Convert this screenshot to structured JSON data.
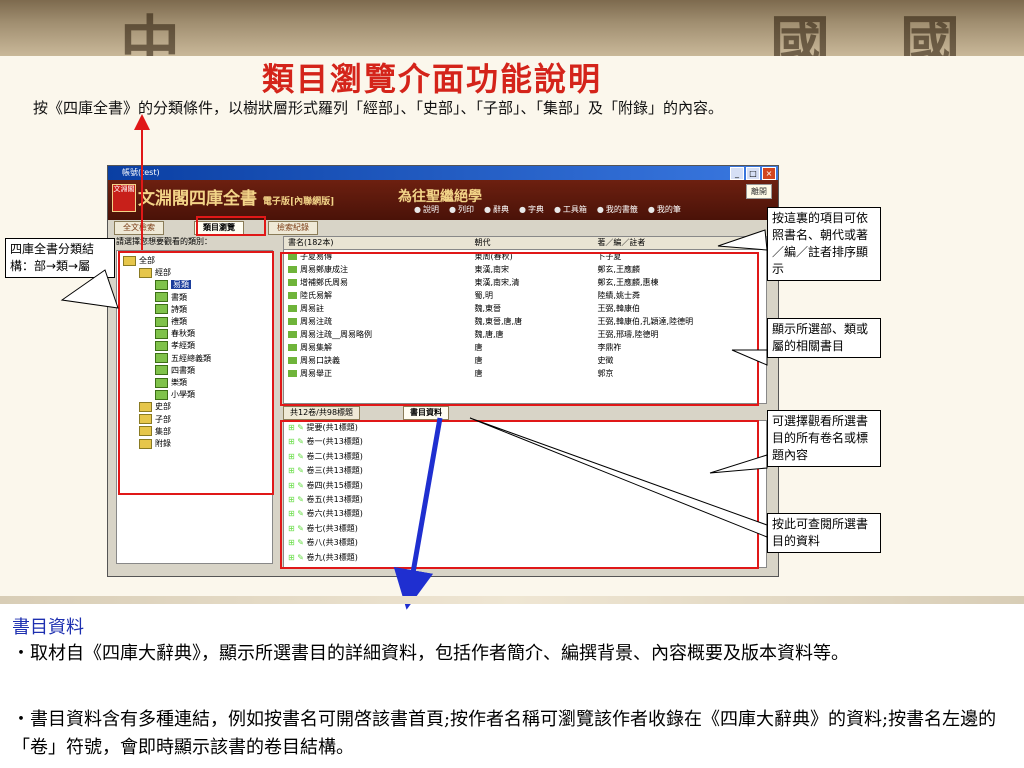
{
  "banner": {
    "glyphs": [
      "中",
      "國",
      "國"
    ]
  },
  "slide": {
    "title": "類目瀏覽介面功能說明",
    "intro": "按《四庫全書》的分類條件，以樹狀層形式羅列「經部」、「史部」、「子部」、「集部」及「附錄」的內容。"
  },
  "app": {
    "window_title": "帳號(test)",
    "logo": "文淵閣",
    "name": "文淵閣四庫全書",
    "edition": "電子版[內聯網版]",
    "motto": "為往聖繼絕學",
    "exit": "離開",
    "toolbar": [
      "說明",
      "列印",
      "辭典",
      "字典",
      "工具箱",
      "我的書籤",
      "我的筆"
    ],
    "tabs": [
      "全文檢索",
      "類目瀏覽",
      "檢索紀錄"
    ],
    "tree_prompt": "請選擇您想要觀看的類別：",
    "tree": [
      {
        "label": "全部",
        "level": 0
      },
      {
        "label": "經部",
        "level": 1
      },
      {
        "label": "易類",
        "level": 2,
        "selected": true
      },
      {
        "label": "書類",
        "level": 2
      },
      {
        "label": "詩類",
        "level": 2
      },
      {
        "label": "禮類",
        "level": 2
      },
      {
        "label": "春秋類",
        "level": 2
      },
      {
        "label": "孝經類",
        "level": 2
      },
      {
        "label": "五經總義類",
        "level": 2
      },
      {
        "label": "四書類",
        "level": 2
      },
      {
        "label": "樂類",
        "level": 2
      },
      {
        "label": "小學類",
        "level": 2
      },
      {
        "label": "史部",
        "level": 1
      },
      {
        "label": "子部",
        "level": 1
      },
      {
        "label": "集部",
        "level": 1
      },
      {
        "label": "附錄",
        "level": 1
      }
    ],
    "grid_headers": [
      "書名(182本)",
      "朝代",
      "著／編／註者"
    ],
    "grid_rows": [
      [
        "子夏易傳",
        "東周(春秋)",
        "卜子夏"
      ],
      [
        "周易鄭康成注",
        "東漢,南宋",
        "鄭玄,王應麟"
      ],
      [
        "增補鄭氏周易",
        "東漢,南宋,清",
        "鄭玄,王應麟,惠棟"
      ],
      [
        "陸氏易解",
        "蜀,明",
        "陸績,姚士粦"
      ],
      [
        "周易註",
        "魏,東晉",
        "王弼,韓康伯"
      ],
      [
        "周易注疏",
        "魏,東晉,唐,唐",
        "王弼,韓康伯,孔穎達,陸德明"
      ],
      [
        "周易注疏__周易略例",
        "魏,唐,唐",
        "王弼,邢璹,陸德明"
      ],
      [
        "周易集解",
        "唐",
        "李鼎祚"
      ],
      [
        "周易口訣義",
        "唐",
        "史徵"
      ],
      [
        "周易舉正",
        "唐",
        "郭京"
      ]
    ],
    "subtabs": [
      "共12卷/共98標題",
      "書目資料"
    ],
    "volumes": [
      "提要(共1標題)",
      "卷一(共13標題)",
      "卷二(共13標題)",
      "卷三(共13標題)",
      "卷四(共15標題)",
      "卷五(共13標題)",
      "卷六(共13標題)",
      "卷七(共3標題)",
      "卷八(共3標題)",
      "卷九(共3標題)"
    ]
  },
  "callouts": {
    "tree": "四庫全書分類結構：部→類→屬",
    "sort": "按這裏的項目可依照書名、朝代或著／編／註者排序顯示",
    "list": "顯示所選部、類或屬的相關書目",
    "volumes": "可選擇觀看所選書目的所有卷名或標題內容",
    "bibinfo": "按此可查閱所選書目的資料"
  },
  "lower": {
    "heading": "書目資料",
    "p1": "・取材自《四庫大辭典》，顯示所選書目的詳細資料，包括作者簡介、編撰背景、內容概要及版本資料等。",
    "p2": "・書目資料含有多種連結，例如按書名可開啓該書首頁;按作者名稱可瀏覽該作者收錄在《四庫大辭典》的資料;按書名左邊的「卷」符號，會即時顯示該書的卷目結構。"
  },
  "colors": {
    "title": "#d4241a",
    "heading": "#1d2fb0",
    "highlight": "#e01818",
    "arrow_blue": "#1f2fd0",
    "arrow_red": "#e01818"
  }
}
